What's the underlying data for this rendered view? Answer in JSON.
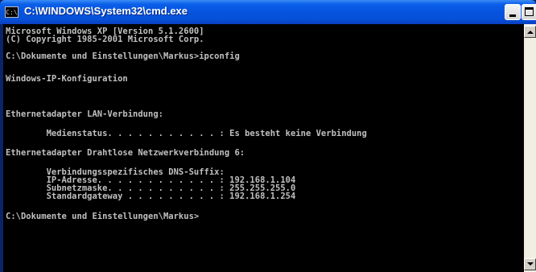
{
  "window": {
    "title": "C:\\WINDOWS\\System32\\cmd.exe",
    "icon": "cmd-console-icon",
    "icon_text": "C:\\"
  },
  "console": {
    "lines": [
      "Microsoft Windows XP [Version 5.1.2600]",
      "(C) Copyright 1985-2001 Microsoft Corp.",
      "",
      "C:\\Dokumente und Einstellungen\\Markus>ipconfig",
      "",
      "Windows-IP-Konfiguration",
      "",
      "",
      "Ethernetadapter LAN-Verbindung:",
      "",
      "        Medienstatus. . . . . . . . . . . : Es besteht keine Verbindung",
      "",
      "Ethernetadapter Drahtlose Netzwerkverbindung 6:",
      "",
      "        Verbindungsspezifisches DNS-Suffix:",
      "        IP-Adresse. . . . . . . . . . . . : 192.168.1.104",
      "        Subnetzmaske. . . . . . . . . . . : 255.255.255.0",
      "        Standardgateway . . . . . . . . . : 192.168.1.254",
      "",
      "C:\\Dokumente und Einstellungen\\Markus>"
    ]
  },
  "colors": {
    "titlebar": "#0654df",
    "console_background": "#000000",
    "console_text": "#c0c0c0"
  }
}
